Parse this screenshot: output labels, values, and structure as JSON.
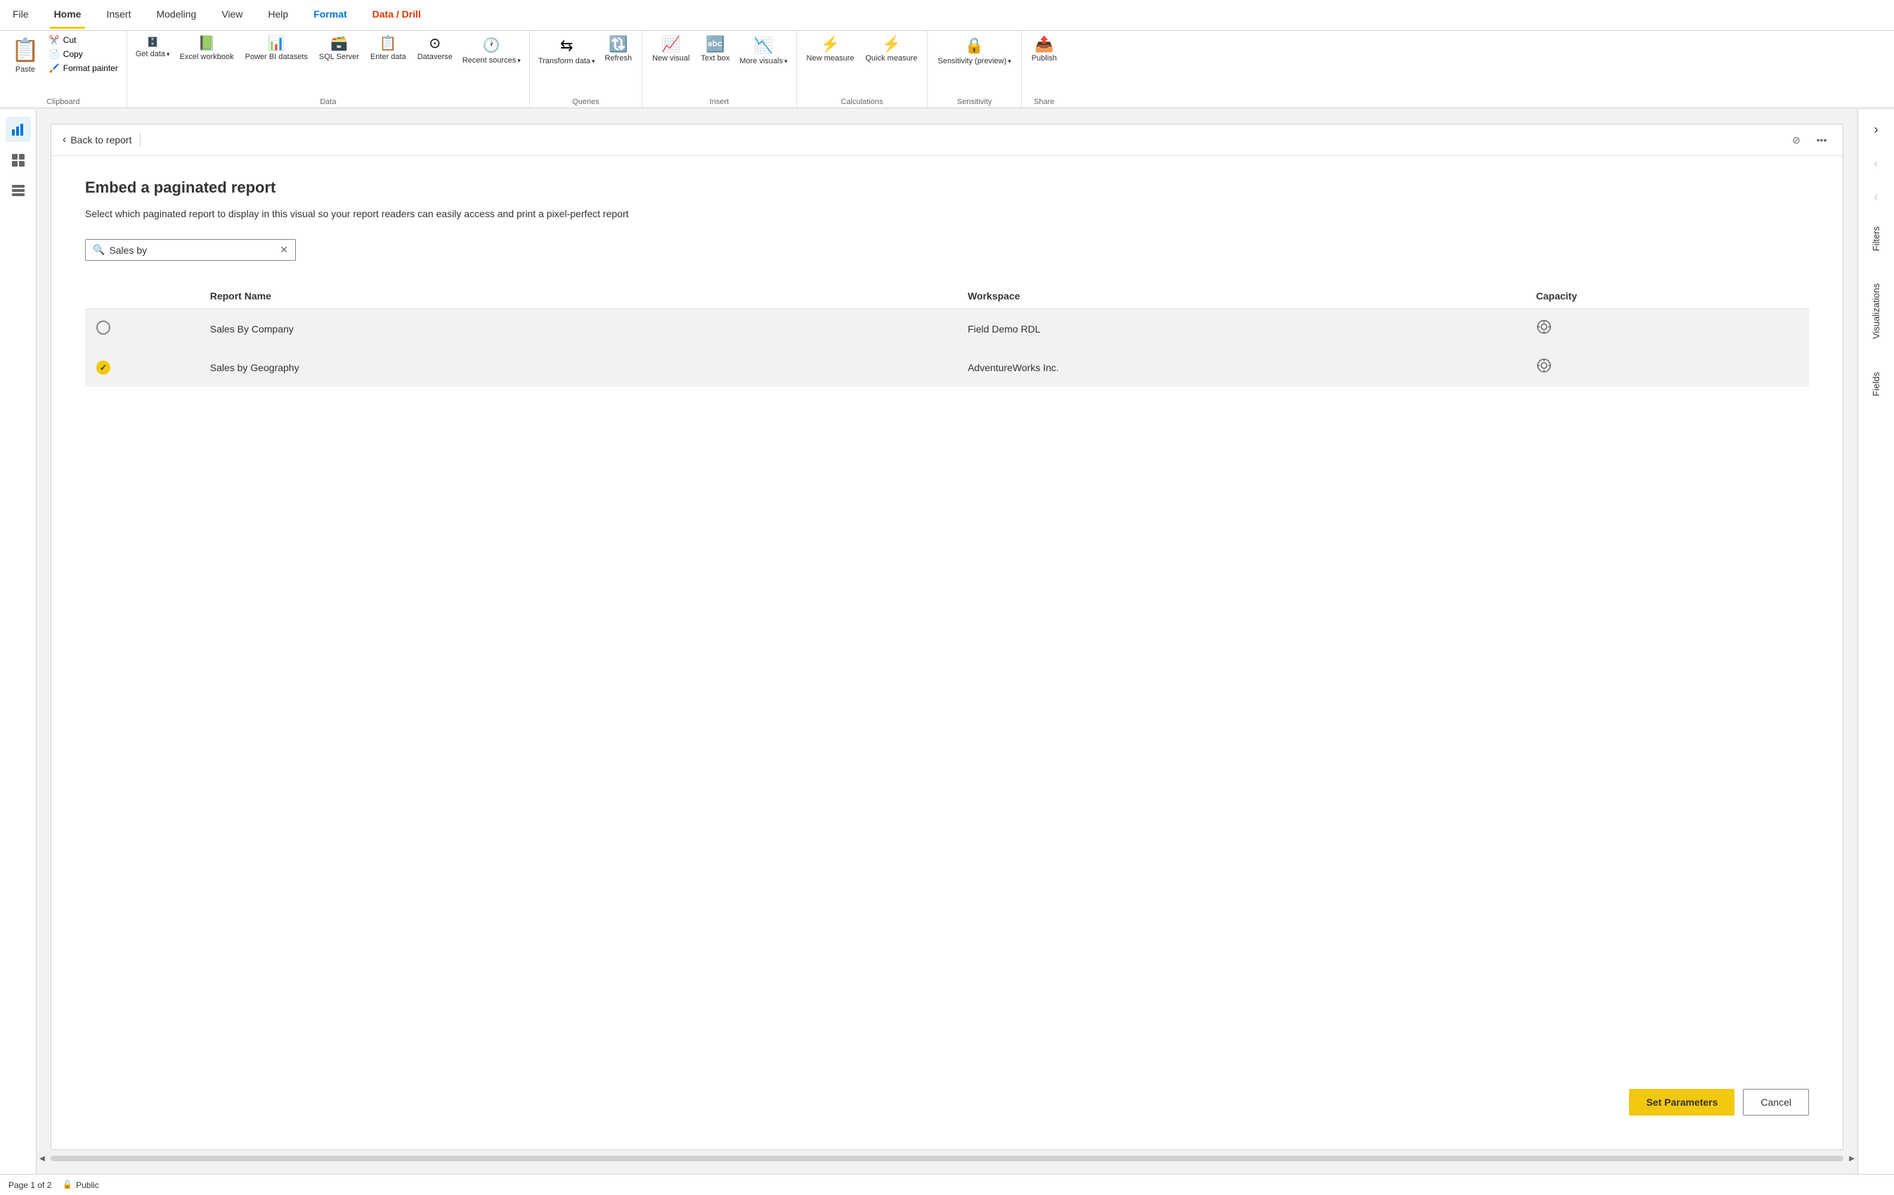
{
  "menu": {
    "items": [
      {
        "id": "file",
        "label": "File",
        "active": false
      },
      {
        "id": "home",
        "label": "Home",
        "active": true
      },
      {
        "id": "insert",
        "label": "Insert",
        "active": false
      },
      {
        "id": "modeling",
        "label": "Modeling",
        "active": false
      },
      {
        "id": "view",
        "label": "View",
        "active": false
      },
      {
        "id": "help",
        "label": "Help",
        "active": false
      },
      {
        "id": "format",
        "label": "Format",
        "active": false,
        "special": "format"
      },
      {
        "id": "data-drill",
        "label": "Data / Drill",
        "active": false,
        "special": "data-drill"
      }
    ]
  },
  "ribbon": {
    "clipboard": {
      "label": "Clipboard",
      "paste": "Paste",
      "cut": "Cut",
      "copy": "Copy",
      "format_painter": "Format painter"
    },
    "data": {
      "label": "Data",
      "get_data": "Get data",
      "excel_workbook": "Excel workbook",
      "power_bi_datasets": "Power BI datasets",
      "sql_server": "SQL Server",
      "enter_data": "Enter data",
      "dataverse": "Dataverse",
      "recent_sources": "Recent sources"
    },
    "queries": {
      "label": "Queries",
      "transform_data": "Transform data",
      "refresh": "Refresh"
    },
    "insert": {
      "label": "Insert",
      "new_visual": "New visual",
      "text_box": "Text box",
      "more_visuals": "More visuals"
    },
    "calculations": {
      "label": "Calculations",
      "new_measure": "New measure",
      "quick_measure": "Quick measure"
    },
    "sensitivity": {
      "label": "Sensitivity",
      "sensitivity_preview": "Sensitivity (preview)"
    },
    "share": {
      "label": "Share",
      "publish": "Publish"
    }
  },
  "dialog": {
    "back_label": "Back to report",
    "title": "Embed a paginated report",
    "description": "Select which paginated report to display in this visual so your report readers can easily access and print a pixel-perfect report",
    "search_placeholder": "Sales by",
    "search_value": "Sales by",
    "table": {
      "col_radio": "",
      "col_name": "Report Name",
      "col_workspace": "Workspace",
      "col_capacity": "Capacity"
    },
    "rows": [
      {
        "id": "row1",
        "selected": false,
        "report_name": "Sales By Company",
        "workspace": "Field Demo RDL",
        "has_capacity": true
      },
      {
        "id": "row2",
        "selected": true,
        "report_name": "Sales by Geography",
        "workspace": "AdventureWorks Inc.",
        "has_capacity": true
      }
    ],
    "set_parameters_label": "Set Parameters",
    "cancel_label": "Cancel"
  },
  "sidebar": {
    "icons": [
      {
        "id": "bar-chart",
        "label": "Report",
        "active": true
      },
      {
        "id": "table",
        "label": "Data",
        "active": false
      },
      {
        "id": "grid",
        "label": "Model",
        "active": false
      }
    ]
  },
  "right_panel": {
    "filters_label": "Filters",
    "visualizations_label": "Visualizations",
    "fields_label": "Fields"
  },
  "status_bar": {
    "page_label": "Page 1 of 2",
    "public_label": "Public"
  },
  "colors": {
    "accent_yellow": "#f2c811",
    "accent_blue": "#0078d4",
    "accent_orange": "#d83b01",
    "format_tab_blue": "#0078d4",
    "data_drill_orange": "#d83b01"
  }
}
